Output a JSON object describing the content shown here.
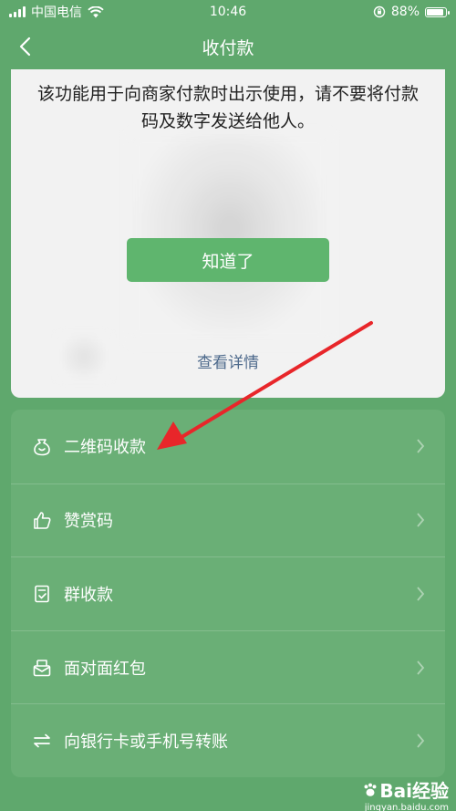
{
  "status_bar": {
    "carrier": "中国电信",
    "time": "10:46",
    "battery": "88%",
    "battery_level": 0.88
  },
  "nav": {
    "title": "收付款"
  },
  "notice": {
    "message": "该功能用于向商家付款时出示使用，请不要将付款码及数字发送给他人。",
    "confirm_label": "知道了",
    "details_label": "查看详情"
  },
  "menu": {
    "items": [
      {
        "label": "二维码收款",
        "icon": "qr-money-bag-icon"
      },
      {
        "label": "赞赏码",
        "icon": "thumbs-up-icon"
      },
      {
        "label": "群收款",
        "icon": "group-receipt-icon"
      },
      {
        "label": "面对面红包",
        "icon": "red-packet-icon"
      },
      {
        "label": "向银行卡或手机号转账",
        "icon": "transfer-arrows-icon"
      }
    ]
  },
  "watermark": {
    "brand": "Bai经验",
    "site": "jingyan.baidu.com"
  },
  "colors": {
    "background": "#5fa86d",
    "menu_card": "#6aaf76",
    "button": "#5fb56e",
    "link": "#4e6a8c",
    "arrow": "#e8262a"
  }
}
